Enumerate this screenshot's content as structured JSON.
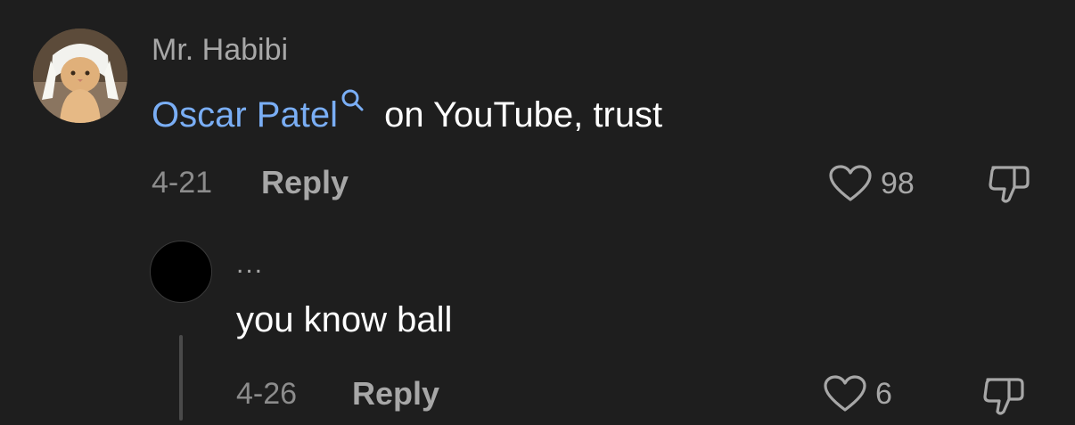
{
  "comment": {
    "username": "Mr. Habibi",
    "avatar_icon": "cat-avatar",
    "mention": "Oscar Patel",
    "mention_icon": "search-icon",
    "text": " on YouTube, trust",
    "date": "4-21",
    "reply_label": "Reply",
    "like_icon": "heart-outline-icon",
    "like_count": "98",
    "dislike_icon": "thumbs-down-icon"
  },
  "reply": {
    "username": "...",
    "avatar_icon": "black-circle-avatar",
    "text": "you know ball",
    "date": "4-26",
    "reply_label": "Reply",
    "like_icon": "heart-outline-icon",
    "like_count": "6",
    "dislike_icon": "thumbs-down-icon"
  },
  "colors": {
    "background": "#1e1e1e",
    "mention": "#7aaef5",
    "secondary_text": "#a7a7a7",
    "primary_text": "#ffffff"
  }
}
